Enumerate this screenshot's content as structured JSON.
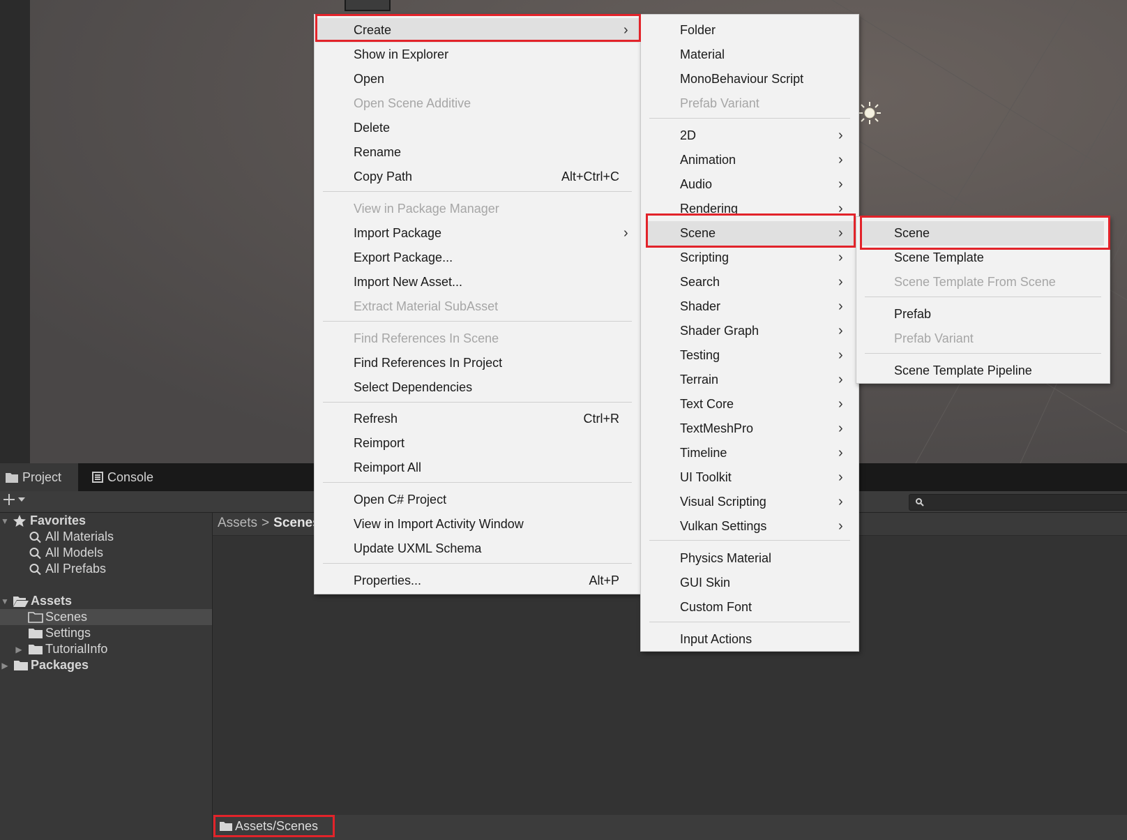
{
  "colors": {
    "highlight_red": "#e2232a",
    "menu_bg": "#f2f2f2",
    "panel_bg": "#383838"
  },
  "tabs": {
    "project": "Project",
    "console": "Console"
  },
  "project_tree": {
    "favorites": "Favorites",
    "all_materials": "All Materials",
    "all_models": "All Models",
    "all_prefabs": "All Prefabs",
    "assets": "Assets",
    "scenes": "Scenes",
    "settings": "Settings",
    "tutorialinfo": "TutorialInfo",
    "packages": "Packages"
  },
  "breadcrumb": {
    "root": "Assets",
    "separator": ">",
    "current": "Scenes"
  },
  "footer_path": "Assets/Scenes",
  "context_menu": {
    "items": [
      {
        "label": "Create",
        "submenu": true
      },
      {
        "label": "Show in Explorer"
      },
      {
        "label": "Open"
      },
      {
        "label": "Open Scene Additive",
        "disabled": true
      },
      {
        "label": "Delete"
      },
      {
        "label": "Rename"
      },
      {
        "label": "Copy Path",
        "shortcut": "Alt+Ctrl+C"
      },
      {
        "label": "View in Package Manager",
        "disabled": true
      },
      {
        "label": "Import Package",
        "submenu": true
      },
      {
        "label": "Export Package..."
      },
      {
        "label": "Import New Asset..."
      },
      {
        "label": "Extract Material SubAsset",
        "disabled": true
      },
      {
        "label": "Find References In Scene",
        "disabled": true
      },
      {
        "label": "Find References In Project"
      },
      {
        "label": "Select Dependencies"
      },
      {
        "label": "Refresh",
        "shortcut": "Ctrl+R"
      },
      {
        "label": "Reimport"
      },
      {
        "label": "Reimport All"
      },
      {
        "label": "Open C# Project"
      },
      {
        "label": "View in Import Activity Window"
      },
      {
        "label": "Update UXML Schema"
      },
      {
        "label": "Properties...",
        "shortcut": "Alt+P"
      }
    ]
  },
  "create_menu": {
    "items": [
      {
        "label": "Folder"
      },
      {
        "label": "Material"
      },
      {
        "label": "MonoBehaviour Script"
      },
      {
        "label": "Prefab Variant",
        "disabled": true
      },
      {
        "label": "2D",
        "submenu": true
      },
      {
        "label": "Animation",
        "submenu": true
      },
      {
        "label": "Audio",
        "submenu": true
      },
      {
        "label": "Rendering",
        "submenu": true
      },
      {
        "label": "Scene",
        "submenu": true
      },
      {
        "label": "Scripting",
        "submenu": true
      },
      {
        "label": "Search",
        "submenu": true
      },
      {
        "label": "Shader",
        "submenu": true
      },
      {
        "label": "Shader Graph",
        "submenu": true
      },
      {
        "label": "Testing",
        "submenu": true
      },
      {
        "label": "Terrain",
        "submenu": true
      },
      {
        "label": "Text Core",
        "submenu": true
      },
      {
        "label": "TextMeshPro",
        "submenu": true
      },
      {
        "label": "Timeline",
        "submenu": true
      },
      {
        "label": "UI Toolkit",
        "submenu": true
      },
      {
        "label": "Visual Scripting",
        "submenu": true
      },
      {
        "label": "Vulkan Settings",
        "submenu": true
      },
      {
        "label": "Physics Material"
      },
      {
        "label": "GUI Skin"
      },
      {
        "label": "Custom Font"
      },
      {
        "label": "Input Actions"
      }
    ]
  },
  "scene_menu": {
    "items": [
      {
        "label": "Scene"
      },
      {
        "label": "Scene Template"
      },
      {
        "label": "Scene Template From Scene",
        "disabled": true
      },
      {
        "label": "Prefab"
      },
      {
        "label": "Prefab Variant",
        "disabled": true
      },
      {
        "label": "Scene Template Pipeline"
      }
    ]
  }
}
